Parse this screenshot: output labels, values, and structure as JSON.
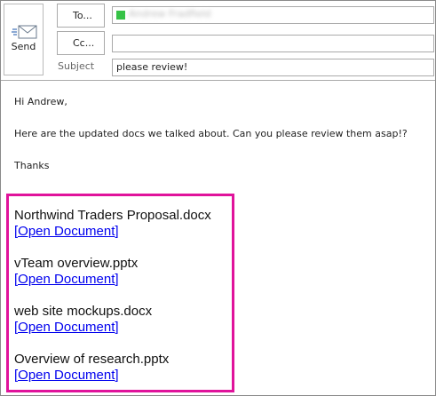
{
  "header": {
    "send_label": "Send",
    "to_label": "To...",
    "cc_label": "Cc...",
    "subject_label": "Subject",
    "to_value": "Andrew Fradfield",
    "cc_value": "",
    "subject_value": "please review!"
  },
  "body": {
    "greeting": "Hi Andrew,",
    "message": "Here are the updated docs we talked about. Can you please review them asap!?",
    "signoff": "Thanks"
  },
  "attachments": [
    {
      "name": "Northwind Traders Proposal.docx",
      "link": "[Open Document]"
    },
    {
      "name": "vTeam overview.pptx",
      "link": "[Open Document]"
    },
    {
      "name": "web site mockups.docx",
      "link": "[Open Document]"
    },
    {
      "name": "Overview of research.pptx",
      "link": "[Open Document]"
    }
  ],
  "colors": {
    "highlight_border": "#e0139b",
    "link": "#0000ee",
    "recipient_presence": "#36c246"
  }
}
